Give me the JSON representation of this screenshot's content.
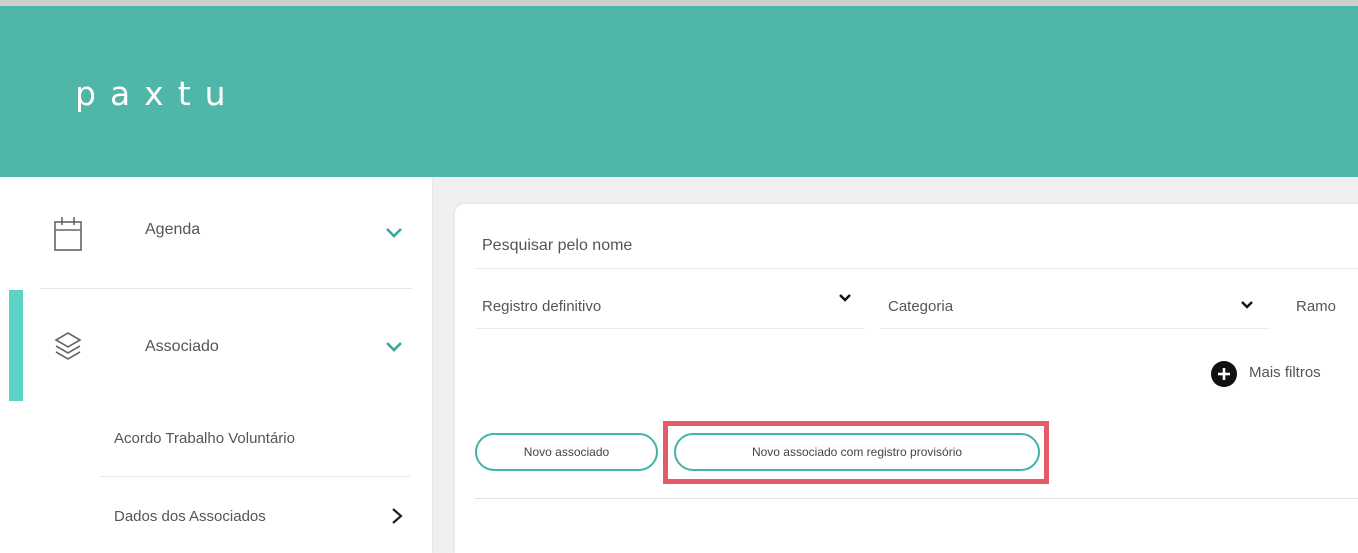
{
  "app": {
    "logo": "paxtu"
  },
  "colors": {
    "header": "#4fb6a8",
    "accent": "#42b3a6",
    "active_indicator": "#5cd2c6",
    "highlight": "#e35c68"
  },
  "sidebar": {
    "items": [
      {
        "label": "Agenda",
        "icon": "calendar-icon"
      },
      {
        "label": "Associado",
        "icon": "layers-icon"
      }
    ],
    "subitems": [
      {
        "label": "Acordo Trabalho Voluntário"
      },
      {
        "label": "Dados dos Associados"
      }
    ]
  },
  "main": {
    "search": {
      "placeholder": "Pesquisar pelo nome"
    },
    "filters": {
      "registro": "Registro definitivo",
      "categoria": "Categoria",
      "ramo": "Ramo"
    },
    "more_filters": "Mais filtros",
    "buttons": {
      "novo_associado": "Novo associado",
      "novo_associado_provisorio": "Novo associado com registro provisório"
    }
  }
}
